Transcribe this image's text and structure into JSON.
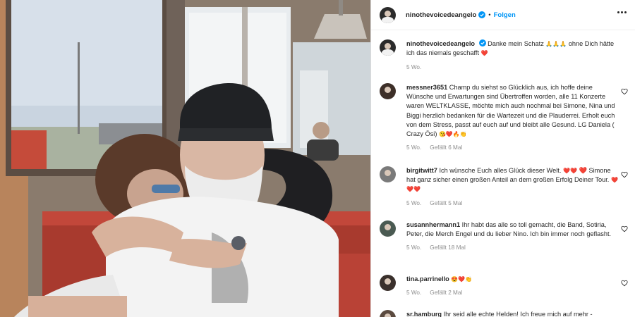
{
  "post": {
    "author": "ninothevoicedeangelo",
    "follow_label": "Folgen",
    "separator": "•",
    "more_label": "More options"
  },
  "caption": {
    "username": "ninothevoicedeangelo",
    "text_1": "Danke mein Schatz",
    "emojis_1": "🙏🙏🙏",
    "text_2": "ohne Dich hätte ich das niemals geschafft",
    "emoji_end": "❤️",
    "time": "5 Wo."
  },
  "comments": [
    {
      "username": "messner3651",
      "text": "Champ du siehst so Glücklich aus, ich hoffe deine Wünsche und Erwartungen sind Übertroffen worden, alle 11 Konzerte waren WELTKLASSE, möchte mich auch nochmal bei Simone, Nina und Biggi herzlich bedanken für die Wartezeit und die Plauderrei. Erholt euch von dem Stress, passt auf euch auf und bleibt alle Gesund. LG Daniela ( Crazy Ösi)",
      "emojis": "😘❤️🔥👏",
      "time": "5 Wo.",
      "likes": "Gefällt 6 Mal"
    },
    {
      "username": "birgitwitt7",
      "text": "Ich wünsche Euch alles Glück dieser Welt.",
      "emojis": "❤️❤️",
      "text_2": "❤️ Simone hat ganz sicher einen großen Anteil an dem großen Erfolg Deiner Tour.",
      "emojis_2": "❤️❤️❤️",
      "time": "5 Wo.",
      "likes": "Gefällt 5 Mal"
    },
    {
      "username": "susannhermann1",
      "text": "Ihr habt das alle so toll gemacht, die Band, Sotiria, Peter, die Merch Engel und du lieber Nino. Ich bin immer noch geflasht.",
      "time": "5 Wo.",
      "likes": "Gefällt 18 Mal"
    },
    {
      "username": "tina.parrinello",
      "emojis": "😍❤️👏",
      "time": "5 Wo.",
      "likes": "Gefällt 2 Mal"
    },
    {
      "username": "sr.hamburg",
      "text": "Ihr seid alle echte Helden! Ich freue mich auf mehr -"
    }
  ],
  "colors": {
    "link_blue": "#0095f6",
    "verified_blue": "#0095f6",
    "meta_grey": "#8e8e8e",
    "heart_red": "#ed4956"
  },
  "icons": {
    "verified": "verified-badge-icon",
    "like": "heart-outline-icon",
    "more": "more-horizontal-icon"
  }
}
